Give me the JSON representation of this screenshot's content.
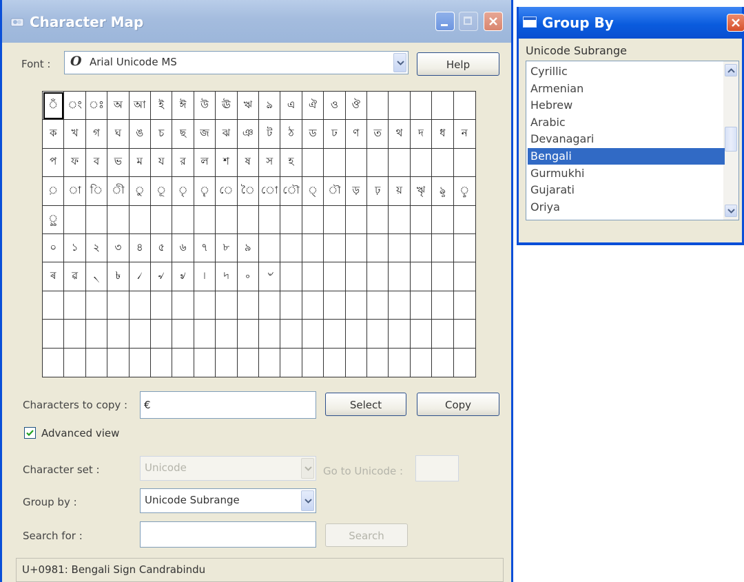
{
  "charmap": {
    "title": "Character Map",
    "font_label": "Font :",
    "font_icon": "opentype-font-icon",
    "font_glyph": "O",
    "font_value": "Arial Unicode MS",
    "help_label": "Help",
    "grid_rows": [
      [
        "ঁ",
        "ং",
        "ঃ",
        "অ",
        "আ",
        "ই",
        "ঈ",
        "উ",
        "ঊ",
        "ঋ",
        "ঌ",
        "এ",
        "ঐ",
        "ও",
        "ঔ",
        "",
        "",
        "",
        "",
        ""
      ],
      [
        "ক",
        "খ",
        "গ",
        "ঘ",
        "ঙ",
        "চ",
        "ছ",
        "জ",
        "ঝ",
        "ঞ",
        "ট",
        "ঠ",
        "ড",
        "ঢ",
        "ণ",
        "ত",
        "থ",
        "দ",
        "ধ",
        "ন"
      ],
      [
        "প",
        "ফ",
        "ব",
        "ভ",
        "ম",
        "য",
        "র",
        "ল",
        "শ",
        "ষ",
        "স",
        "হ",
        "",
        "",
        "",
        "",
        "",
        "",
        "",
        ""
      ],
      [
        "়",
        "া",
        "ি",
        "ী",
        "ু",
        "ূ",
        "ৃ",
        "ৄ",
        "ে",
        "ৈ",
        "ো",
        "ৌ",
        "্",
        "ৗ",
        "ড়",
        "ঢ়",
        "য়",
        "ৠ",
        "ৡ",
        "ৢ"
      ],
      [
        "ৣ",
        "",
        "",
        "",
        "",
        "",
        "",
        "",
        "",
        "",
        "",
        "",
        "",
        "",
        "",
        "",
        "",
        "",
        "",
        ""
      ],
      [
        "০",
        "১",
        "২",
        "৩",
        "৪",
        "৫",
        "৬",
        "৭",
        "৮",
        "৯",
        "",
        "",
        "",
        "",
        "",
        "",
        "",
        "",
        "",
        ""
      ],
      [
        "ৰ",
        "ৱ",
        "৲",
        "৳",
        "৴",
        "৵",
        "৶",
        "৷",
        "৸",
        "৹",
        "৺",
        "",
        "",
        "",
        "",
        "",
        "",
        "",
        "",
        ""
      ],
      [
        "",
        "",
        "",
        "",
        "",
        "",
        "",
        "",
        "",
        "",
        "",
        "",
        "",
        "",
        "",
        "",
        "",
        "",
        "",
        ""
      ],
      [
        "",
        "",
        "",
        "",
        "",
        "",
        "",
        "",
        "",
        "",
        "",
        "",
        "",
        "",
        "",
        "",
        "",
        "",
        "",
        ""
      ],
      [
        "",
        "",
        "",
        "",
        "",
        "",
        "",
        "",
        "",
        "",
        "",
        "",
        "",
        "",
        "",
        "",
        "",
        "",
        "",
        ""
      ]
    ],
    "chars_to_copy_label": "Characters to copy :",
    "chars_to_copy_value": "€",
    "select_label": "Select",
    "copy_label": "Copy",
    "advanced_view_label": "Advanced view",
    "advanced_view_checked": true,
    "character_set_label": "Character set :",
    "character_set_value": "Unicode",
    "go_to_unicode_label": "Go to Unicode :",
    "go_to_unicode_value": "",
    "group_by_label": "Group by :",
    "group_by_value": "Unicode Subrange",
    "search_for_label": "Search for :",
    "search_value": "",
    "search_button_label": "Search",
    "status_text": "U+0981: Bengali Sign Candrabindu"
  },
  "groupby": {
    "title": "Group By",
    "list_header": "Unicode Subrange",
    "items": [
      "Cyrillic",
      "Armenian",
      "Hebrew",
      "Arabic",
      "Devanagari",
      "Bengali",
      "Gurmukhi",
      "Gujarati",
      "Oriya"
    ],
    "selected_index": 5
  },
  "colors": {
    "titlebar_inactive": "#a4bcde",
    "titlebar_active": "#0a5cde",
    "selection": "#316ac5",
    "window_face": "#ece9d8"
  }
}
